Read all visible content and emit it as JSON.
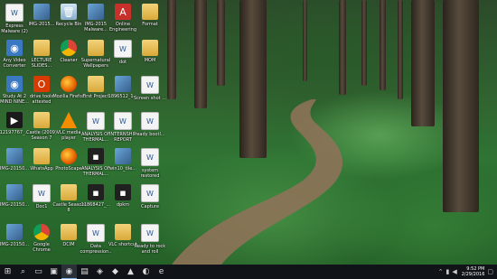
{
  "desktop_icons": [
    {
      "label": "Express Malware (2)",
      "icon": "doc-icon",
      "kind": "doc"
    },
    {
      "label": "IMG-2015...",
      "icon": "image-icon",
      "kind": "photo"
    },
    {
      "label": "Recycle Bin",
      "icon": "recycle-bin-icon",
      "kind": "bin"
    },
    {
      "label": "IMG-2015 Malware...",
      "icon": "image-icon",
      "kind": "photo"
    },
    {
      "label": "Online Engineering",
      "icon": "pdf-icon",
      "kind": "pdf"
    },
    {
      "label": "Format",
      "icon": "folder-icon",
      "kind": "folder"
    },
    {
      "label": "Any Video Converter",
      "icon": "video-converter-icon",
      "kind": "app"
    },
    {
      "label": "LECTURE SLIDES...",
      "icon": "folder-icon",
      "kind": "folder"
    },
    {
      "label": "Cleaner",
      "icon": "ccleaner-icon",
      "kind": "chrome"
    },
    {
      "label": "Supernatural Wallpapers",
      "icon": "folder-icon",
      "kind": "folder"
    },
    {
      "label": "dot",
      "icon": "doc-icon",
      "kind": "doc"
    },
    {
      "label": "MOM",
      "icon": "folder-icon",
      "kind": "folder"
    },
    {
      "label": "Study At 2 MIND NINE...",
      "icon": "app-icon",
      "kind": "app"
    },
    {
      "label": "drive tools attested",
      "icon": "office-icon",
      "kind": "office"
    },
    {
      "label": "Mozilla Firefox",
      "icon": "firefox-icon",
      "kind": "firefox"
    },
    {
      "label": "First Project",
      "icon": "folder-icon",
      "kind": "folder"
    },
    {
      "label": "1896512_1...",
      "icon": "image-icon",
      "kind": "photo"
    },
    {
      "label": "Screen shot ...",
      "icon": "doc-icon",
      "kind": "doc"
    },
    {
      "label": "12197767_...",
      "icon": "video-icon",
      "kind": "video"
    },
    {
      "label": "Castle (2009) Season 7",
      "icon": "folder-icon",
      "kind": "folder"
    },
    {
      "label": "VLC media player",
      "icon": "vlc-icon",
      "kind": "vlc"
    },
    {
      "label": "ANALYSIS OF THERMAL...",
      "icon": "doc-icon",
      "kind": "doc"
    },
    {
      "label": "INTERNSHIP REPORT",
      "icon": "doc-icon",
      "kind": "doc"
    },
    {
      "label": "ready bootl...",
      "icon": "doc-icon",
      "kind": "doc"
    },
    {
      "label": "IMG-20150...",
      "icon": "image-icon",
      "kind": "photo"
    },
    {
      "label": "WhatsApp",
      "icon": "folder-icon",
      "kind": "folder"
    },
    {
      "label": "PhotoScape",
      "icon": "photoscape-icon",
      "kind": "firefox"
    },
    {
      "label": "ANALYSIS OF THERMAL...",
      "icon": "doc-icon",
      "kind": "dark"
    },
    {
      "label": "win10_tile...",
      "icon": "image-icon",
      "kind": "photo"
    },
    {
      "label": "system restored",
      "icon": "doc-icon",
      "kind": "doc"
    },
    {
      "label": "IMG-20150...",
      "icon": "image-icon",
      "kind": "photo"
    },
    {
      "label": "Doc1",
      "icon": "doc-icon",
      "kind": "doc"
    },
    {
      "label": "Castle Season 8",
      "icon": "folder-icon",
      "kind": "folder"
    },
    {
      "label": "11868427_...",
      "icon": "image-icon",
      "kind": "dark"
    },
    {
      "label": "dpkm",
      "icon": "app-icon",
      "kind": "dark"
    },
    {
      "label": "Capture",
      "icon": "doc-icon",
      "kind": "doc"
    },
    {
      "label": "IMG-20150...",
      "icon": "image-icon",
      "kind": "photo"
    },
    {
      "label": "Google Chrome",
      "icon": "chrome-icon",
      "kind": "chrome"
    },
    {
      "label": "DCIM",
      "icon": "folder-icon",
      "kind": "folder"
    },
    {
      "label": "Data compression...",
      "icon": "doc-icon",
      "kind": "doc"
    },
    {
      "label": "VLC shortcut",
      "icon": "folder-icon",
      "kind": "folder"
    },
    {
      "label": "Ready to rock and roll",
      "icon": "doc-icon",
      "kind": "doc"
    }
  ],
  "taskbar": {
    "buttons": [
      {
        "name": "start-button",
        "icon": "windows-icon",
        "glyph": "⊞",
        "active": false
      },
      {
        "name": "search-button",
        "icon": "search-icon",
        "glyph": "⌕",
        "active": false
      },
      {
        "name": "task-view-button",
        "icon": "task-view-icon",
        "glyph": "▭",
        "active": false
      },
      {
        "name": "taskbar-store",
        "icon": "store-icon",
        "glyph": "▣",
        "active": false
      },
      {
        "name": "taskbar-chrome",
        "icon": "chrome-icon",
        "glyph": "◉",
        "active": true
      },
      {
        "name": "taskbar-explorer",
        "icon": "folder-icon",
        "glyph": "▤",
        "active": false
      },
      {
        "name": "taskbar-app1",
        "icon": "app-icon",
        "glyph": "◈",
        "active": false
      },
      {
        "name": "taskbar-app2",
        "icon": "app-icon",
        "glyph": "◆",
        "active": false
      },
      {
        "name": "taskbar-vlc",
        "icon": "vlc-icon",
        "glyph": "▲",
        "active": false
      },
      {
        "name": "taskbar-app3",
        "icon": "app-icon",
        "glyph": "◐",
        "active": false
      },
      {
        "name": "taskbar-edge",
        "icon": "edge-icon",
        "glyph": "e",
        "active": false
      }
    ],
    "tray": {
      "time": "9:52 PM",
      "date": "2/29/2016"
    }
  },
  "colors": {
    "taskbar": "#101418",
    "accent": "#7fb3e8"
  }
}
